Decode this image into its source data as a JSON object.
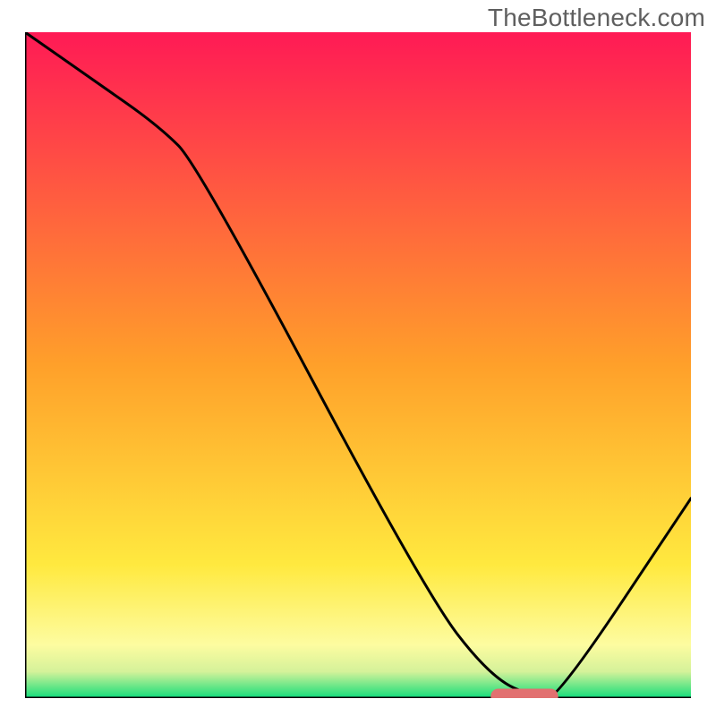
{
  "watermark": {
    "text": "TheBottleneck.com"
  },
  "colors": {
    "gradient_stops": [
      {
        "offset": 0.0,
        "color": "#ff1a55"
      },
      {
        "offset": 0.5,
        "color": "#ffa02a"
      },
      {
        "offset": 0.8,
        "color": "#ffe93f"
      },
      {
        "offset": 0.92,
        "color": "#fdfca0"
      },
      {
        "offset": 0.96,
        "color": "#d5f29a"
      },
      {
        "offset": 0.995,
        "color": "#2be07e"
      },
      {
        "offset": 1.0,
        "color": "#00d07a"
      }
    ],
    "axis": "#000000",
    "curve": "#000000",
    "marker_fill": "#e27070",
    "marker_stroke": "#e27070"
  },
  "chart_data": {
    "type": "line",
    "title": "",
    "xlabel": "",
    "ylabel": "",
    "xlim": [
      0,
      100
    ],
    "ylim": [
      0,
      100
    ],
    "x": [
      0,
      10,
      20,
      26,
      60,
      70,
      77,
      80,
      100
    ],
    "values": [
      100,
      93,
      86,
      80,
      16,
      3,
      0,
      0,
      30
    ],
    "marker": {
      "x_start": 70,
      "x_end": 80,
      "y": 0
    },
    "annotations": []
  }
}
